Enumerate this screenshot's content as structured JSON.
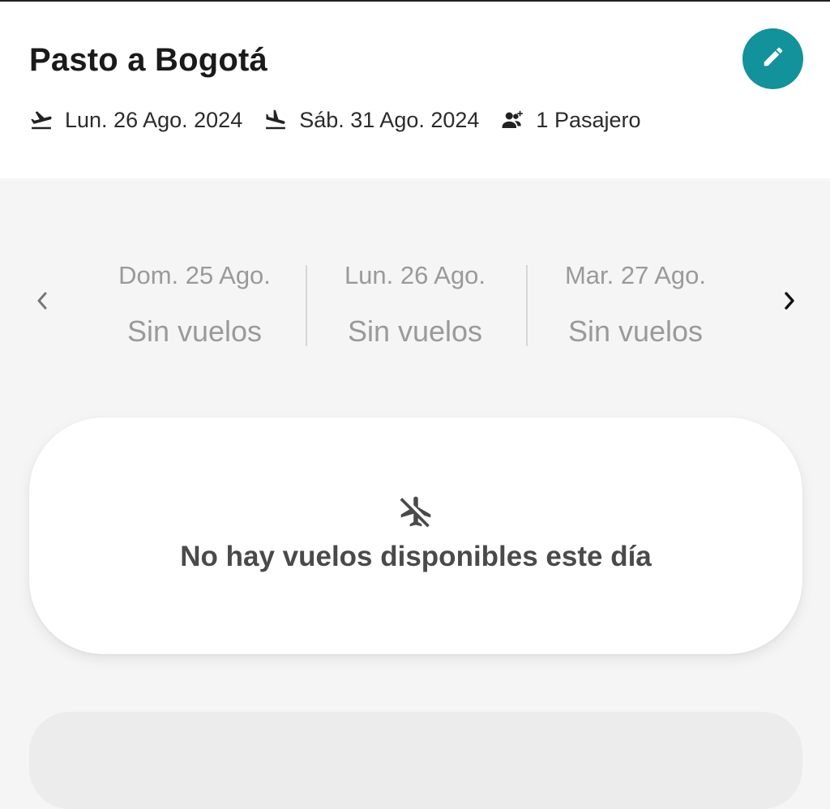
{
  "header": {
    "route_title": "Pasto a Bogotá",
    "departure_date": "Lun. 26 Ago. 2024",
    "return_date": "Sáb. 31 Ago. 2024",
    "passengers": "1 Pasajero",
    "icons": {
      "departure": "takeoff-icon",
      "return": "landing-icon",
      "passengers": "add-passenger-icon",
      "edit": "pencil-icon"
    },
    "accent_color": "#12929a"
  },
  "date_selector": {
    "days": [
      {
        "date": "Dom. 25 Ago.",
        "status": "Sin vuelos"
      },
      {
        "date": "Lun. 26 Ago.",
        "status": "Sin vuelos"
      },
      {
        "date": "Mar. 27 Ago.",
        "status": "Sin vuelos"
      }
    ],
    "prev_icon": "chevron-left-icon",
    "next_icon": "chevron-right-icon"
  },
  "empty_state": {
    "message": "No hay vuelos disponibles este día",
    "icon": "no-flights-icon"
  }
}
